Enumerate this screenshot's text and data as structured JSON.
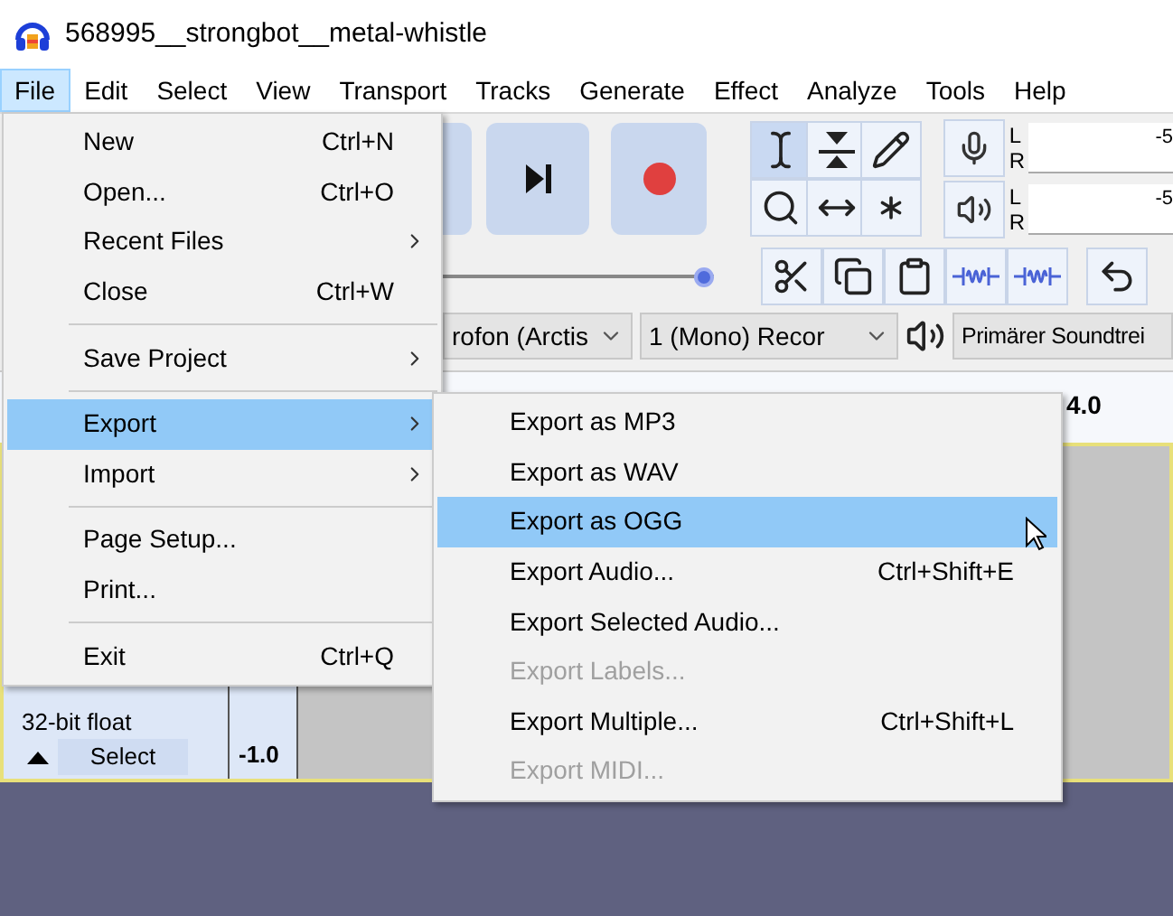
{
  "window": {
    "title": "568995__strongbot__metal-whistle"
  },
  "menubar": [
    {
      "label": "File",
      "selected": true
    },
    {
      "label": "Edit",
      "selected": false
    },
    {
      "label": "Select",
      "selected": false
    },
    {
      "label": "View",
      "selected": false
    },
    {
      "label": "Transport",
      "selected": false
    },
    {
      "label": "Tracks",
      "selected": false
    },
    {
      "label": "Generate",
      "selected": false
    },
    {
      "label": "Effect",
      "selected": false
    },
    {
      "label": "Analyze",
      "selected": false
    },
    {
      "label": "Tools",
      "selected": false
    },
    {
      "label": "Help",
      "selected": false
    }
  ],
  "tools": [
    {
      "kind": "select",
      "selected": true
    },
    {
      "kind": "envelope",
      "selected": false
    },
    {
      "kind": "draw",
      "selected": false
    },
    {
      "kind": "zoom",
      "selected": false
    },
    {
      "kind": "timeshift",
      "selected": false
    },
    {
      "kind": "multi",
      "selected": false
    }
  ],
  "meters": [
    {
      "kind": "record",
      "channels": [
        "L",
        "R"
      ],
      "reading": "-5"
    },
    {
      "kind": "play",
      "channels": [
        "L",
        "R"
      ],
      "reading": "-5"
    }
  ],
  "devices": {
    "input": "rofon (Arctis",
    "channels": "1 (Mono) Recor",
    "output": "Primärer Soundtrei"
  },
  "volume_slider": {
    "level": 1
  },
  "ruler": {
    "label": "4.0"
  },
  "track": {
    "format": "32-bit float",
    "select_button": "Select",
    "scale_label": "-1.0"
  },
  "file_menu": [
    {
      "kind": "item",
      "label": "New",
      "shortcut": "Ctrl+N",
      "submenu": false,
      "selected": false
    },
    {
      "kind": "item",
      "label": "Open...",
      "shortcut": "Ctrl+O",
      "submenu": false,
      "selected": false
    },
    {
      "kind": "item",
      "label": "Recent Files",
      "submenu": true,
      "selected": false
    },
    {
      "kind": "item",
      "label": "Close",
      "shortcut": "Ctrl+W",
      "submenu": false,
      "selected": false
    },
    {
      "kind": "separator"
    },
    {
      "kind": "item",
      "label": "Save Project",
      "submenu": true,
      "selected": false
    },
    {
      "kind": "separator"
    },
    {
      "kind": "item",
      "label": "Export",
      "submenu": true,
      "selected": true
    },
    {
      "kind": "item",
      "label": "Import",
      "submenu": true,
      "selected": false
    },
    {
      "kind": "separator"
    },
    {
      "kind": "item",
      "label": "Page Setup...",
      "submenu": false,
      "selected": false
    },
    {
      "kind": "item",
      "label": "Print...",
      "submenu": false,
      "selected": false
    },
    {
      "kind": "separator"
    },
    {
      "kind": "item",
      "label": "Exit",
      "shortcut": "Ctrl+Q",
      "submenu": false,
      "selected": false
    }
  ],
  "export_menu": [
    {
      "label": "Export as MP3",
      "selected": false,
      "disabled": false
    },
    {
      "label": "Export as WAV",
      "selected": false,
      "disabled": false
    },
    {
      "label": "Export as OGG",
      "selected": true,
      "disabled": false
    },
    {
      "label": "Export Audio...",
      "shortcut": "Ctrl+Shift+E",
      "selected": false,
      "disabled": false
    },
    {
      "label": "Export Selected Audio...",
      "selected": false,
      "disabled": false
    },
    {
      "label": "Export Labels...",
      "selected": false,
      "disabled": true
    },
    {
      "label": "Export Multiple...",
      "shortcut": "Ctrl+Shift+L",
      "selected": false,
      "disabled": false
    },
    {
      "label": "Export MIDI...",
      "selected": false,
      "disabled": true
    }
  ]
}
